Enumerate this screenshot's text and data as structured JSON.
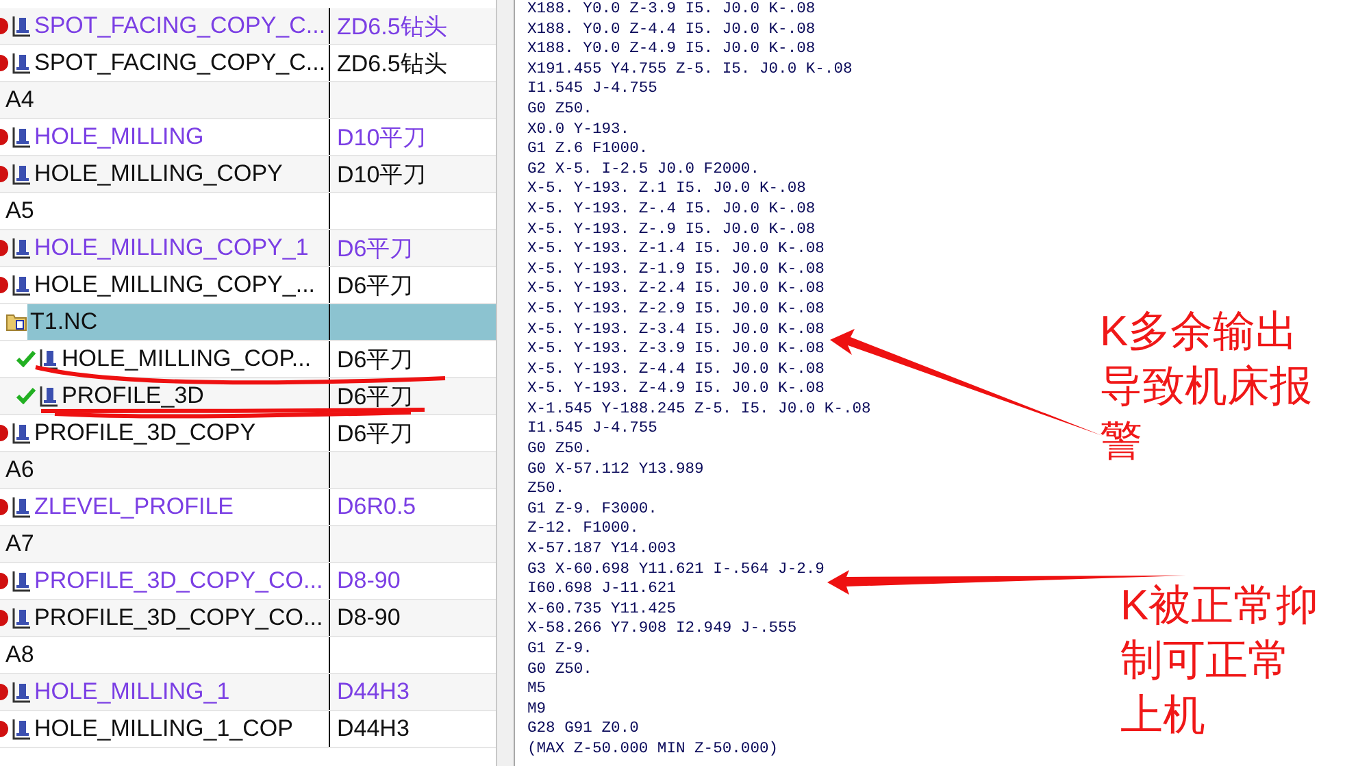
{
  "operation_navigator": {
    "rows": [
      {
        "kind": "operation",
        "name": "SPOT_FACING_COPY_C...",
        "tool": "ZD6.5钻头",
        "modified": true,
        "complete": false,
        "selected": false
      },
      {
        "kind": "operation",
        "name": "SPOT_FACING_COPY_C...",
        "tool": "ZD6.5钻头",
        "modified": false,
        "complete": false,
        "selected": false
      },
      {
        "kind": "group",
        "name": "A4",
        "selected": false
      },
      {
        "kind": "operation",
        "name": "HOLE_MILLING",
        "tool": "D10平刀",
        "modified": true,
        "complete": false,
        "selected": false
      },
      {
        "kind": "operation",
        "name": "HOLE_MILLING_COPY",
        "tool": "D10平刀",
        "modified": false,
        "complete": false,
        "selected": false
      },
      {
        "kind": "group",
        "name": "A5",
        "selected": false
      },
      {
        "kind": "operation",
        "name": "HOLE_MILLING_COPY_1",
        "tool": "D6平刀",
        "modified": true,
        "complete": false,
        "selected": false
      },
      {
        "kind": "operation",
        "name": "HOLE_MILLING_COPY_...",
        "tool": "D6平刀",
        "modified": false,
        "complete": false,
        "selected": false
      },
      {
        "kind": "program",
        "name": "T1.NC",
        "selected": true
      },
      {
        "kind": "child",
        "name": "HOLE_MILLING_COP...",
        "tool": "D6平刀",
        "modified": false,
        "complete": true,
        "selected": false
      },
      {
        "kind": "child",
        "name": "PROFILE_3D",
        "tool": "D6平刀",
        "modified": false,
        "complete": true,
        "selected": false
      },
      {
        "kind": "operation",
        "name": "PROFILE_3D_COPY",
        "tool": "D6平刀",
        "modified": false,
        "complete": false,
        "selected": false
      },
      {
        "kind": "group",
        "name": "A6",
        "selected": false
      },
      {
        "kind": "operation",
        "name": "ZLEVEL_PROFILE",
        "tool": "D6R0.5",
        "modified": true,
        "complete": false,
        "selected": false
      },
      {
        "kind": "group",
        "name": "A7",
        "selected": false
      },
      {
        "kind": "operation",
        "name": "PROFILE_3D_COPY_CO...",
        "tool": "D8-90",
        "modified": true,
        "complete": false,
        "selected": false
      },
      {
        "kind": "operation",
        "name": "PROFILE_3D_COPY_CO...",
        "tool": "D8-90",
        "modified": false,
        "complete": false,
        "selected": false
      },
      {
        "kind": "group",
        "name": "A8",
        "selected": false
      },
      {
        "kind": "operation",
        "name": "HOLE_MILLING_1",
        "tool": "D44H3",
        "modified": true,
        "complete": false,
        "selected": false
      },
      {
        "kind": "operation",
        "name": "HOLE_MILLING_1_COP",
        "tool": "D44H3",
        "modified": false,
        "complete": false,
        "selected": false
      }
    ]
  },
  "nc_code": {
    "lines": [
      "X188. Y0.0 Z-3.9 I5. J0.0 K-.08",
      "X188. Y0.0 Z-4.4 I5. J0.0 K-.08",
      "X188. Y0.0 Z-4.9 I5. J0.0 K-.08",
      "X191.455 Y4.755 Z-5. I5. J0.0 K-.08",
      "I1.545 J-4.755",
      "G0 Z50.",
      "X0.0 Y-193.",
      "G1 Z.6 F1000.",
      "G2 X-5. I-2.5 J0.0 F2000.",
      "X-5. Y-193. Z.1 I5. J0.0 K-.08",
      "X-5. Y-193. Z-.4 I5. J0.0 K-.08",
      "X-5. Y-193. Z-.9 I5. J0.0 K-.08",
      "X-5. Y-193. Z-1.4 I5. J0.0 K-.08",
      "X-5. Y-193. Z-1.9 I5. J0.0 K-.08",
      "X-5. Y-193. Z-2.4 I5. J0.0 K-.08",
      "X-5. Y-193. Z-2.9 I5. J0.0 K-.08",
      "X-5. Y-193. Z-3.4 I5. J0.0 K-.08",
      "X-5. Y-193. Z-3.9 I5. J0.0 K-.08",
      "X-5. Y-193. Z-4.4 I5. J0.0 K-.08",
      "X-5. Y-193. Z-4.9 I5. J0.0 K-.08",
      "X-1.545 Y-188.245 Z-5. I5. J0.0 K-.08",
      "I1.545 J-4.755",
      "G0 Z50.",
      "G0 X-57.112 Y13.989",
      "Z50.",
      "G1 Z-9. F3000.",
      "Z-12. F1000.",
      "X-57.187 Y14.003",
      "G3 X-60.698 Y11.621 I-.564 J-2.9",
      "I60.698 J-11.621",
      "X-60.735 Y11.425",
      "X-58.266 Y7.908 I2.949 J-.555",
      "G1 Z-9.",
      "G0 Z50.",
      "M5",
      "M9",
      "G28 G91 Z0.0",
      "(MAX Z-50.000 MIN Z-50.000)"
    ]
  },
  "annotations": [
    {
      "text": "K多余输出导致机床报警"
    },
    {
      "text": "K被正常抑制可正常上机"
    }
  ]
}
